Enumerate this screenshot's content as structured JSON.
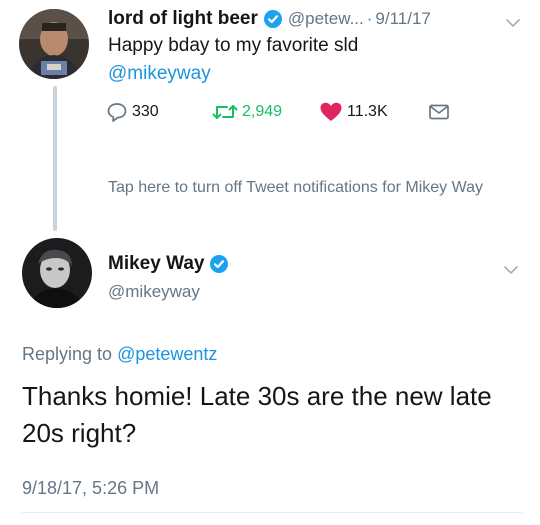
{
  "tweet1": {
    "name": "lord of light beer",
    "handle": "@petew...",
    "separator": "·",
    "date": "9/11/17",
    "text": "Happy bday to my favorite sld",
    "mention": "@mikeyway",
    "reply_count": "330",
    "retweet_count": "2,949",
    "like_count": "11.3K",
    "notification_text": "Tap here to turn off Tweet notifications for Mikey Way"
  },
  "tweet2": {
    "name": "Mikey Way",
    "handle": "@mikeyway",
    "replying_prefix": "Replying to",
    "replying_to": "@petewentz",
    "text": "Thanks homie! Late 30s are the new late 20s right?",
    "timestamp": "9/18/17, 5:26 PM"
  },
  "colors": {
    "verified": "#1da1f2",
    "mention": "#1b95e0",
    "retweet": "#17bf63",
    "like": "#e0245e",
    "muted": "#657786"
  },
  "icons": [
    "verified-badge-icon",
    "chevron-down-icon",
    "reply-icon",
    "retweet-icon",
    "heart-icon",
    "direct-message-icon"
  ]
}
